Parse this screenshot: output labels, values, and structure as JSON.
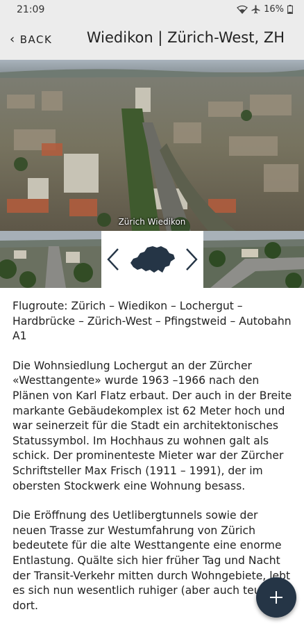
{
  "status_bar": {
    "time": "21:09",
    "battery": "16%"
  },
  "header": {
    "back_label": "BACK",
    "title": "Wiedikon | Zürich-West, ZH"
  },
  "hero": {
    "caption": "Zürich Wiedikon"
  },
  "thumbnails": {
    "map_icon": "switzerland-map-icon"
  },
  "article": {
    "paragraphs": [
      "Flugroute: Zürich – Wiedikon – Lochergut – Hardbrücke – Zürich-West – Pfingstweid – Autobahn A1",
      "Die Wohnsiedlung Lochergut an der Zürcher «Westtangente» wurde 1963 –1966 nach den Plänen von Karl Flatz erbaut. Der auch in der Breite markante Gebäudekomplex ist 62 Meter hoch und war seinerzeit für die Stadt ein architektonisches Statussymbol. Im Hochhaus zu wohnen galt als schick. Der prominenteste Mieter war der Zürcher Schriftsteller Max Frisch (1911 – 1991), der im obersten Stockwerk eine Wohnung besass.",
      "Die Eröffnung des Uetlibergtunnels sowie der neuen Trasse zur Westumfahrung von Zürich bedeutete für die alte Westtangente eine enorme Entlastung. Quälte sich hier früher Tag und Nacht der Transit-Verkehr mitten durch Wohngebiete, lebt es sich nun wesentlich ruhiger (aber auch teurer) dort."
    ]
  },
  "fab": {
    "label": "+"
  },
  "colors": {
    "fab": "#253546",
    "appbar": "#ececec",
    "map": "#253546"
  }
}
